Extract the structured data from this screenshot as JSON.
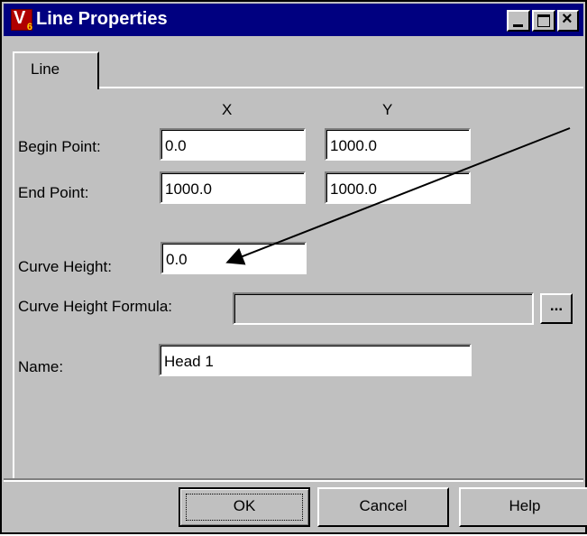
{
  "window": {
    "title": "Line Properties",
    "icon": "app-v-icon",
    "icon_letter": "V",
    "icon_badge": "6",
    "controls": {
      "minimize": "minimize-icon",
      "maximize": "maximize-icon",
      "close": "close-icon"
    }
  },
  "tabs": [
    {
      "label": "Line",
      "selected": true
    }
  ],
  "columns": {
    "x": "X",
    "y": "Y"
  },
  "fields": {
    "begin_point": {
      "label": "Begin Point:",
      "x": "0.0",
      "y": "1000.0"
    },
    "end_point": {
      "label": "End Point:",
      "x": "1000.0",
      "y": "1000.0"
    },
    "curve_height": {
      "label": "Curve Height:",
      "value": "0.0"
    },
    "curve_height_formula": {
      "label": "Curve Height Formula:",
      "value": "",
      "button": "..."
    },
    "name": {
      "label": "Name:",
      "value": "Head 1"
    }
  },
  "buttons": {
    "ok": "OK",
    "cancel": "Cancel",
    "help": "Help"
  },
  "colors": {
    "titlebar": "#000080",
    "face": "#c0c0c0",
    "field": "#ffffff"
  }
}
